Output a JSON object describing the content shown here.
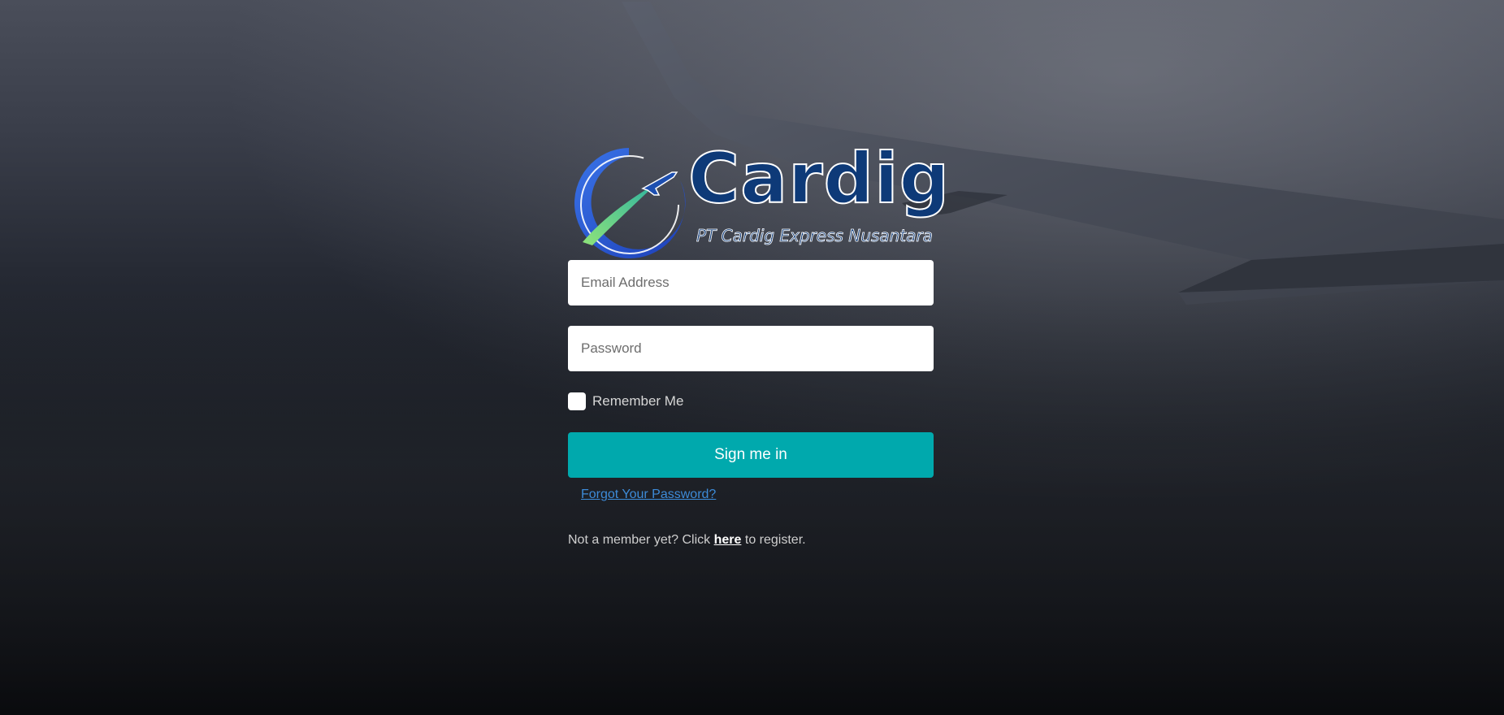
{
  "logo": {
    "wordmark": "Cardig",
    "tagline": "PT Cardig Express Nusantara"
  },
  "form": {
    "email_placeholder": "Email Address",
    "password_placeholder": "Password",
    "remember_label": "Remember Me",
    "submit_label": "Sign me in",
    "forgot_label": "Forgot Your Password?"
  },
  "register": {
    "prefix": "Not a member yet? Click",
    "link": "here",
    "suffix": "to register."
  },
  "colors": {
    "primary_button": "#00a9ad",
    "link": "#3d8bd8",
    "logo_blue": "#0e3a78",
    "logo_green": "#5fd07a"
  }
}
